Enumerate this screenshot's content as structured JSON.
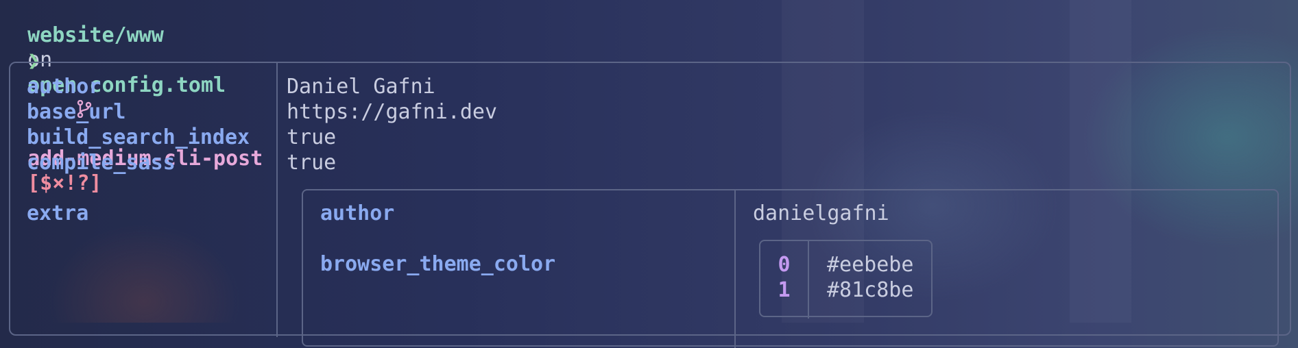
{
  "prompt": {
    "path": "website/www",
    "on": "on",
    "branch_icon": "git-branch-icon",
    "branch": "add-medium-cli-post",
    "status": "[$×!?]",
    "chevron": "❯",
    "command": "open config.toml"
  },
  "config": {
    "rows": [
      {
        "key": "author",
        "value": "Daniel Gafni"
      },
      {
        "key": "base_url",
        "value": "https://gafni.dev"
      },
      {
        "key": "build_search_index",
        "value": "true"
      },
      {
        "key": "compile_sass",
        "value": "true"
      }
    ],
    "extra": {
      "key": "extra",
      "rows": [
        {
          "key": "author",
          "value": "danielgafni"
        },
        {
          "key": "browser_theme_color"
        }
      ],
      "browser_theme_color": [
        {
          "index": "0",
          "value": "#eebebe"
        },
        {
          "index": "1",
          "value": "#81c8be"
        }
      ]
    }
  },
  "colors": {
    "key": "#8aaaf0",
    "path": "#8ed6c2",
    "branch": "#e7a9da",
    "status": "#ef8da0",
    "index": "#c49af0",
    "border": "#5c6587"
  }
}
